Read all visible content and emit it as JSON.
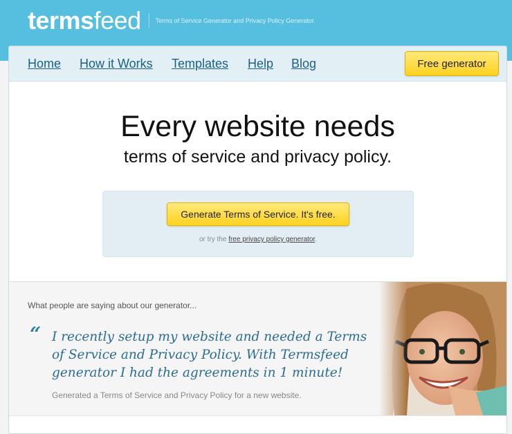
{
  "brand": {
    "logo_bold": "terms",
    "logo_light": "feed",
    "tagline": "Terms of Service Generator and Privacy Policy Generator."
  },
  "nav": {
    "items": [
      {
        "label": "Home"
      },
      {
        "label": "How it Works"
      },
      {
        "label": "Templates"
      },
      {
        "label": "Help"
      },
      {
        "label": "Blog"
      }
    ],
    "cta_label": "Free generator"
  },
  "hero": {
    "title": "Every website needs",
    "subtitle": "terms of service and privacy policy."
  },
  "cta": {
    "button_label": "Generate Terms of Service. It's free.",
    "note_prefix": "or try the ",
    "note_link": "free privacy policy generator",
    "note_suffix": "."
  },
  "testimonial": {
    "heading": "What people are saying about our generator...",
    "quote_mark": "“",
    "quote": "I recently setup my website and needed a Terms of Service and Privacy Policy. With Termsfeed generator I had the agreements in 1 minute!",
    "caption": "Generated a Terms of Service and Privacy Policy for a new website."
  },
  "colors": {
    "header_bg": "#56bfe0",
    "nav_bg": "#e2f0f5",
    "link": "#1b5f86",
    "button_yellow": "#ffd21f",
    "quote": "#2b6c93"
  }
}
